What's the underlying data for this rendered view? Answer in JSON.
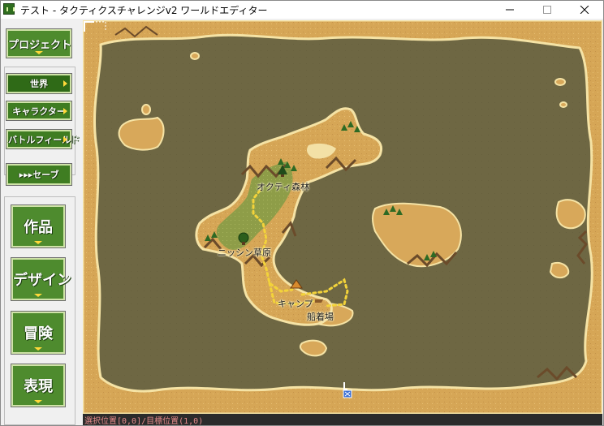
{
  "window": {
    "title": "テスト - タクティクスチャレンジv2 ワールドエディター",
    "controls": [
      "minimize",
      "maximize",
      "close"
    ]
  },
  "sidebar": {
    "project": "プロジェクト",
    "nav": [
      {
        "label": "世界",
        "selected": true
      },
      {
        "label": "キャラクター",
        "selected": false
      },
      {
        "label": "バトルフィールド",
        "selected": false
      }
    ],
    "save": "▸▸▸セーブ",
    "modes": [
      {
        "label": "作品"
      },
      {
        "label": "デザイン"
      },
      {
        "label": "冒険"
      },
      {
        "label": "表現"
      }
    ]
  },
  "map": {
    "locations": [
      {
        "name": "オクティ森林"
      },
      {
        "name": "ニッシン草原"
      },
      {
        "name": "キャンプ"
      },
      {
        "name": "船着場"
      }
    ],
    "colors": {
      "sea": "#6e6743",
      "land": "#d8a85a",
      "coast": "#f5e3a5",
      "grass": "#8fa14a",
      "road": "#f3d33a"
    }
  },
  "status": {
    "text": "選択位置[0,0]/目標位置(1,0)"
  }
}
